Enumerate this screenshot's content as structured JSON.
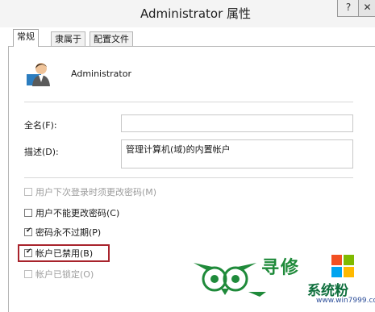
{
  "window": {
    "title": "Administrator 属性",
    "help_glyph": "?",
    "close_glyph": "✕"
  },
  "tabs": [
    {
      "label": "常规",
      "active": true
    },
    {
      "label": "隶属于",
      "active": false
    },
    {
      "label": "配置文件",
      "active": false
    }
  ],
  "user": {
    "name": "Administrator"
  },
  "fields": {
    "fullname": {
      "label": "全名(F):",
      "value": ""
    },
    "description": {
      "label": "描述(D):",
      "value": "管理计算机(域)的内置帐户"
    }
  },
  "options": [
    {
      "label": "用户下次登录时须更改密码(M)",
      "checked": false,
      "enabled": false
    },
    {
      "label": "用户不能更改密码(C)",
      "checked": false,
      "enabled": true
    },
    {
      "label": "密码永不过期(P)",
      "checked": true,
      "enabled": true
    },
    {
      "label": "帐户已禁用(B)",
      "checked": true,
      "enabled": true,
      "highlighted": true
    },
    {
      "label": "帐户已锁定(O)",
      "checked": false,
      "enabled": false
    }
  ],
  "watermark": {
    "brand": "寻修",
    "site_name": "系统粉",
    "url": "www.win7999.com",
    "windows_colors": [
      "#f25022",
      "#7fba00",
      "#00a4ef",
      "#ffb900"
    ]
  }
}
